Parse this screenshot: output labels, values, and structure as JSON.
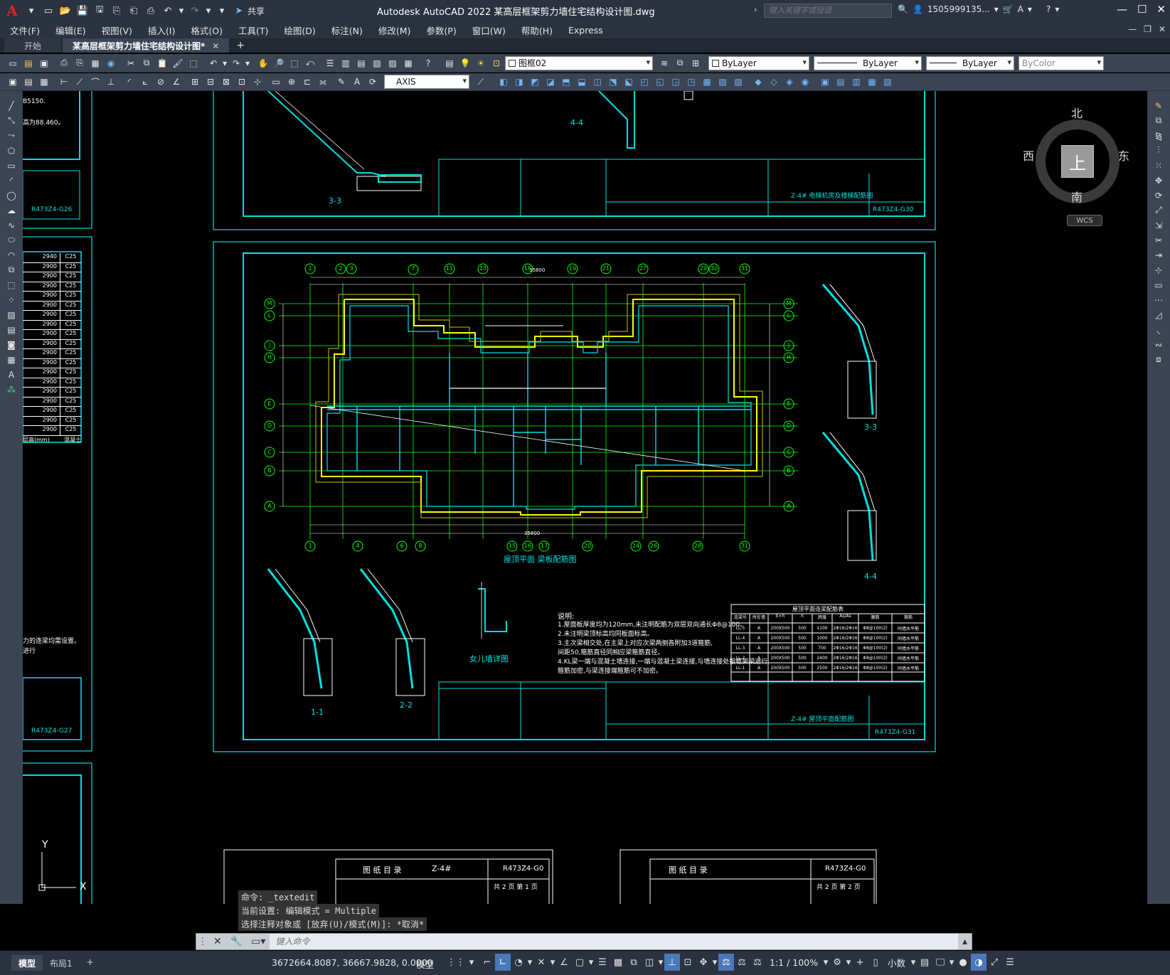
{
  "app": {
    "title": "Autodesk AutoCAD 2022    某高层框架剪力墙住宅结构设计图.dwg",
    "share_label": "共享",
    "search_placeholder": "键入关键字或短语",
    "user": "1505999135...",
    "logo": "A"
  },
  "menu": [
    "文件(F)",
    "编辑(E)",
    "视图(V)",
    "插入(I)",
    "格式(O)",
    "工具(T)",
    "绘图(D)",
    "标注(N)",
    "修改(M)",
    "参数(P)",
    "窗口(W)",
    "帮助(H)",
    "Express"
  ],
  "tabs": [
    {
      "label": "开始",
      "active": false
    },
    {
      "label": "某高层框架剪力墙住宅结构设计图*",
      "active": true
    }
  ],
  "toolbar1": {
    "layer": "图框02",
    "color": "ByLayer",
    "linetype": "ByLayer",
    "lineweight": "ByLayer",
    "plotstyle": "ByColor"
  },
  "toolbar2": {
    "dimstyle": "AXIS"
  },
  "viewcube": {
    "north": "北",
    "south": "南",
    "east": "东",
    "west": "西",
    "face": "上",
    "wcs": "WCS"
  },
  "drawing": {
    "top_sheet_caption": "3-3",
    "top_sheet_caption2": "4-4",
    "top_sheet_number": "R473Z4-G30",
    "top_sheet_title": "Z-4# 电梯机房及楼梯配筋图",
    "left_sheet_number_top": "R473Z4-G26",
    "left_sheet_number_mid": "R473Z4-G27",
    "main_sheet_number": "R473Z4-G31",
    "main_sheet_title": "Z-4# 屋顶平面配筋图",
    "plan_caption": "屋顶平面  梁板配筋图",
    "parapet_caption": "女儿墙详图",
    "section_1": "1-1",
    "section_2": "2-2",
    "section_3": "3-3",
    "section_4": "4-4",
    "notes_title": "说明:",
    "notes": [
      "1.屋面板厚度均为120mm,未注明配筋为双层双向通长Φ8@100。",
      "2.未注明梁顶标高均同板面标高。",
      "3.主次梁相交处,在主梁上对应次梁两侧各附加3道箍筋,",
      "  间距50,箍筋直径同相应梁箍筋直径。",
      "4.KL梁一端与混凝土墙连接,一端与混凝土梁连接,与墙连接处按框架梁进行",
      "  箍筋加密,与梁连接端箍筋可不加密。"
    ],
    "table_title": "屋顶平面连梁配筋表",
    "table_headers": [
      "连梁号",
      "所在墙",
      "b×h",
      "h",
      "跨度",
      "As/As",
      "腰筋",
      "箍筋"
    ],
    "table_rows": [
      [
        "LL-5",
        "A",
        "200X500",
        "500",
        "1100",
        "2Φ16/2Φ16",
        "Φ8@100(2)",
        "同墙水平筋"
      ],
      [
        "LL-4",
        "A",
        "200X500",
        "500",
        "1000",
        "2Φ16/2Φ16",
        "Φ8@100(2)",
        "同墙水平筋"
      ],
      [
        "LL-3",
        "A",
        "200X500",
        "500",
        "700",
        "2Φ16/2Φ16",
        "Φ8@100(2)",
        "同墙水平筋"
      ],
      [
        "LL-2",
        "A",
        "200X500",
        "500",
        "2400",
        "2Φ16/2Φ16",
        "Φ8@100(2)",
        "同墙水平筋"
      ],
      [
        "LL-1",
        "A",
        "200X500",
        "500",
        "2500",
        "2Φ16/2Φ16",
        "Φ8@100(2)",
        "同墙水平筋"
      ]
    ],
    "left_table_values": [
      "2940",
      "2900",
      "2900",
      "2900",
      "2900",
      "2900",
      "2900",
      "2900",
      "2900",
      "2900",
      "2900",
      "2900",
      "2900",
      "2900",
      "2900",
      "2900",
      "2900",
      "2900",
      "2900"
    ],
    "left_table_grade": "C25",
    "left_table_footer": "层高(mm)",
    "left_table_footer2": "混凝土",
    "left_note_1": "B5150.",
    "left_note_2": "高为88.460。",
    "left_note_3": "力的连梁均需设置。",
    "left_note_4": "进行",
    "bottom_list_title": "图 纸 目 录",
    "bottom_list_title2": "图 纸 目 录",
    "bottom_list_no": "R473Z4-G0",
    "bottom_list_no2": "R473Z4-G0",
    "bottom_list_proj": "Z-4#",
    "bottom_list_page": "共 2 页  第 1 页",
    "bottom_list_page2": "共 2 页  第 2 页",
    "grid_top": [
      "1",
      "2",
      "3",
      "7",
      "11",
      "13",
      "16",
      "19",
      "21",
      "27",
      "29",
      "30",
      "31"
    ],
    "grid_bottom": [
      "1",
      "4",
      "6",
      "8",
      "15",
      "16",
      "17",
      "20",
      "24",
      "26",
      "28",
      "31"
    ],
    "grid_left": [
      "M",
      "L",
      "J",
      "H",
      "E",
      "D",
      "C",
      "B",
      "A"
    ],
    "total_dim_top": "35800",
    "total_dim_bottom": "35800"
  },
  "command": {
    "history": [
      "命令: _textedit",
      "当前设置: 编辑模式 = Multiple",
      "选择注释对象或 [放弃(U)/模式(M)]: *取消*"
    ],
    "placeholder": "键入命令"
  },
  "ucs": {
    "y_label": "Y",
    "x_label": "X"
  },
  "status": {
    "layouts": [
      {
        "label": "模型",
        "active": true
      },
      {
        "label": "布局1",
        "active": false
      }
    ],
    "add_layout": "+",
    "coords": "3672664.8087, 36667.9828, 0.0000",
    "space": "模型",
    "scale": "1:1 / 100%",
    "units": "小数"
  }
}
